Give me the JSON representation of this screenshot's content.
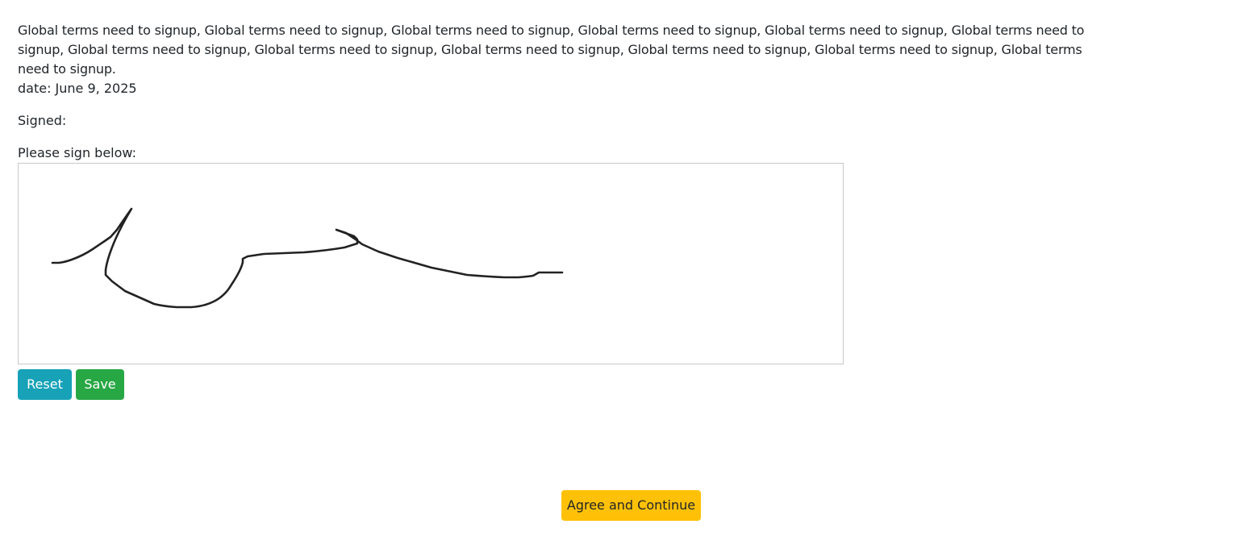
{
  "terms": {
    "text": "Global terms need to signup, Global terms need to signup, Global terms need to signup, Global terms need to signup, Global terms need to signup, Global terms need to signup, Global terms need to signup, Global terms need to signup, Global terms need to signup, Global terms need to signup, Global terms need to signup, Global terms need to signup."
  },
  "date_line": "date: June 9, 2025",
  "signed_line": "Signed:",
  "sign_label": "Please sign below:",
  "signature_pad": {
    "stroke_color": "#222222",
    "background": "#ffffff",
    "border_color": "#c8c8c8"
  },
  "buttons": {
    "reset": "Reset",
    "save": "Save",
    "agree": "Agree and Continue"
  },
  "colors": {
    "reset": "#17a2b8",
    "save": "#28a745",
    "agree": "#ffc107"
  }
}
